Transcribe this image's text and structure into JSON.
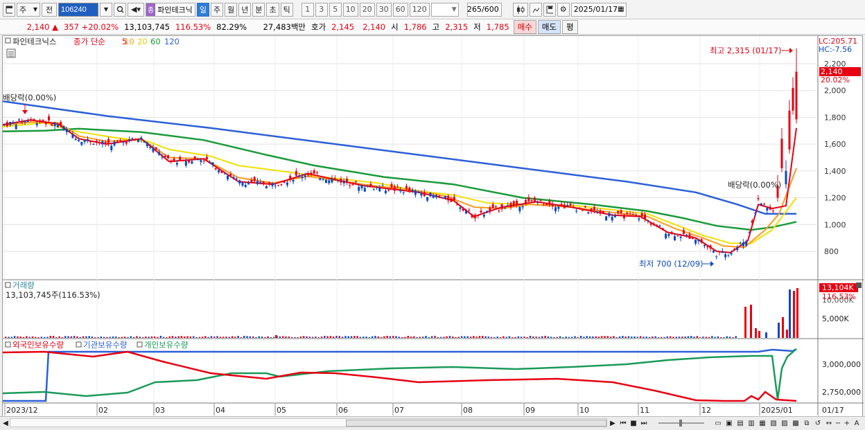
{
  "toolbar": {
    "market_label": "주",
    "period_label": "전",
    "code_value": "106240",
    "stock_tag": "종",
    "stock_name": "파인테크닉",
    "periods": [
      "일",
      "주",
      "월",
      "년",
      "분",
      "초",
      "틱"
    ],
    "active_period": "일",
    "minutes": [
      "1",
      "3",
      "5",
      "10",
      "20",
      "30",
      "60",
      "120"
    ],
    "count_value": "265",
    "count_total": "/600",
    "date_value": "2025/01/17"
  },
  "quote": {
    "price": "2,140",
    "change": "357",
    "change_pct": "+20.02%",
    "volume": "13,103,745",
    "volume_ratio": "116.53%",
    "turnover": "82.29%",
    "amount": "27,483백만",
    "ask_label": "호가",
    "ask1": "2,145",
    "ask2": "2,140",
    "open_label": "시",
    "open": "1,786",
    "high_label": "고",
    "high": "2,315",
    "low_label": "저",
    "low": "1,785",
    "buy_label": "매수",
    "sell_label": "매도",
    "avg_label": "평"
  },
  "price_panel": {
    "legend_name": "파인테크닉스",
    "legend_type": "종가 단순",
    "ma_labels": [
      "5",
      "10",
      "20",
      "60",
      "120"
    ],
    "ma_colors": [
      "#e60012",
      "#ff9a1e",
      "#f0e000",
      "#1a9a3a",
      "#2b5fd8"
    ],
    "lc_label": "LC:205.71",
    "hc_label": "HC:-7.56",
    "price_tag": "2,140",
    "pct_tag": "20.02%",
    "high_annot": "최고 2,315 (01/17)",
    "low_annot": "최저 700 (12/09)",
    "div_annot_left": "배당락(0.00%)",
    "div_annot_right": "배당락(0.00%)",
    "y_ticks": [
      "2,200",
      "2,000",
      "1,800",
      "1,600",
      "1,400",
      "1,200",
      "1,000",
      "800"
    ]
  },
  "volume_panel": {
    "title": "거래량",
    "value": "13,103,745주(116.53%)",
    "tag": "13,104K",
    "tag_pct": "116.53%",
    "tick_top": "10,000K",
    "tick_mid": "5,000K"
  },
  "holding_panel": {
    "foreign": "외국인보유수량",
    "inst": "기관보유수량",
    "indiv": "개인보유수량",
    "tick_top": "3,000,000",
    "tick_mid": "2,750,000"
  },
  "x_axis": {
    "labels": [
      "2023/12",
      "02",
      "03",
      "04",
      "05",
      "06",
      "07",
      "08",
      "09",
      "10",
      "11",
      "12",
      "2025/01"
    ],
    "right_label": "01/17"
  },
  "colors": {
    "up": "#e60012",
    "down": "#0a49c2",
    "accent": "#2e7bd6"
  }
}
